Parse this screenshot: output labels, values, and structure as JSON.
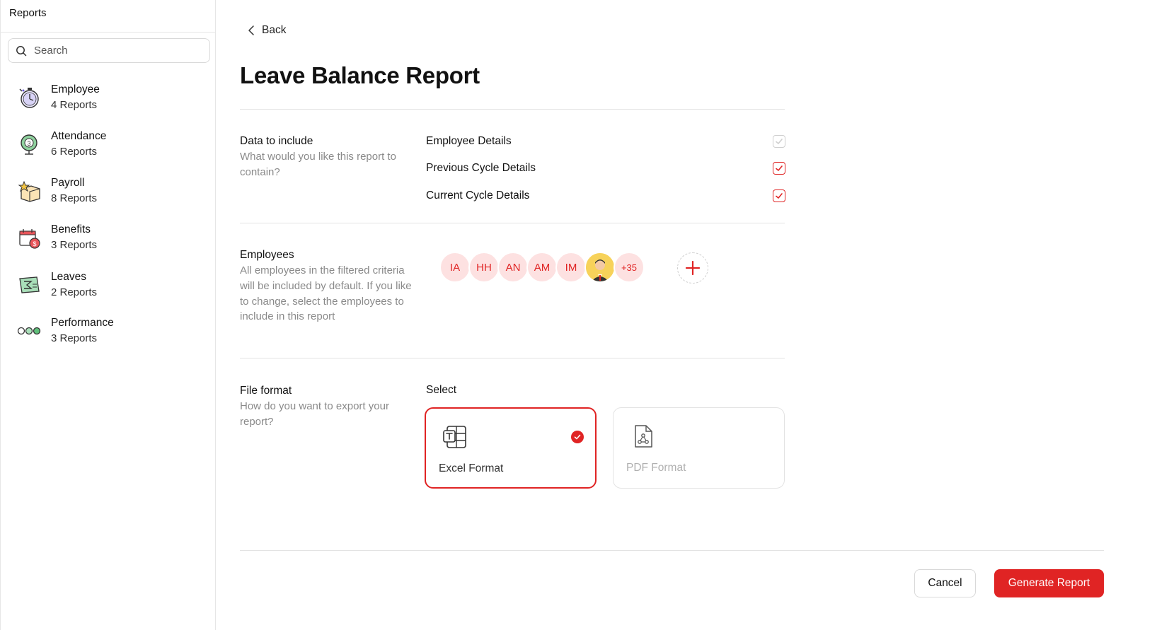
{
  "sidebar": {
    "title": "Reports",
    "search": {
      "placeholder": "Search",
      "value": ""
    },
    "categories": [
      {
        "name": "Employee",
        "count": "4 Reports",
        "icon": "stopwatch-icon"
      },
      {
        "name": "Attendance",
        "count": "6 Reports",
        "icon": "globe-icon"
      },
      {
        "name": "Payroll",
        "count": "8 Reports",
        "icon": "star-box-icon"
      },
      {
        "name": "Benefits",
        "count": "3 Reports",
        "icon": "calendar-coin-icon"
      },
      {
        "name": "Leaves",
        "count": "2 Reports",
        "icon": "sum-sheet-icon"
      },
      {
        "name": "Performance",
        "count": "3 Reports",
        "icon": "circles-icon"
      }
    ]
  },
  "main": {
    "back_label": "Back",
    "title": "Leave Balance Report",
    "data_section": {
      "label": "Data to include",
      "description": "What would you like this report to contain?",
      "options": [
        {
          "label": "Employee Details",
          "checked": true,
          "disabled": true
        },
        {
          "label": "Previous Cycle Details",
          "checked": true,
          "disabled": false
        },
        {
          "label": "Current Cycle Details",
          "checked": true,
          "disabled": false
        }
      ]
    },
    "employees_section": {
      "label": "Employees",
      "description": "All employees in the filtered criteria will be included by default. If you like to change, select the employees to include in this report",
      "avatars": [
        "IA",
        "HH",
        "AN",
        "AM",
        "IM"
      ],
      "more": "+35"
    },
    "format_section": {
      "label": "File format",
      "description": "How do you want to export your report?",
      "select_label": "Select",
      "formats": [
        {
          "label": "Excel Format",
          "selected": true
        },
        {
          "label": "PDF Format",
          "selected": false
        }
      ]
    }
  },
  "footer": {
    "cancel_label": "Cancel",
    "generate_label": "Generate Report"
  },
  "colors": {
    "accent": "#e02424",
    "avatar_bg": "#fde1e1",
    "muted_text": "#8a8a8a"
  }
}
